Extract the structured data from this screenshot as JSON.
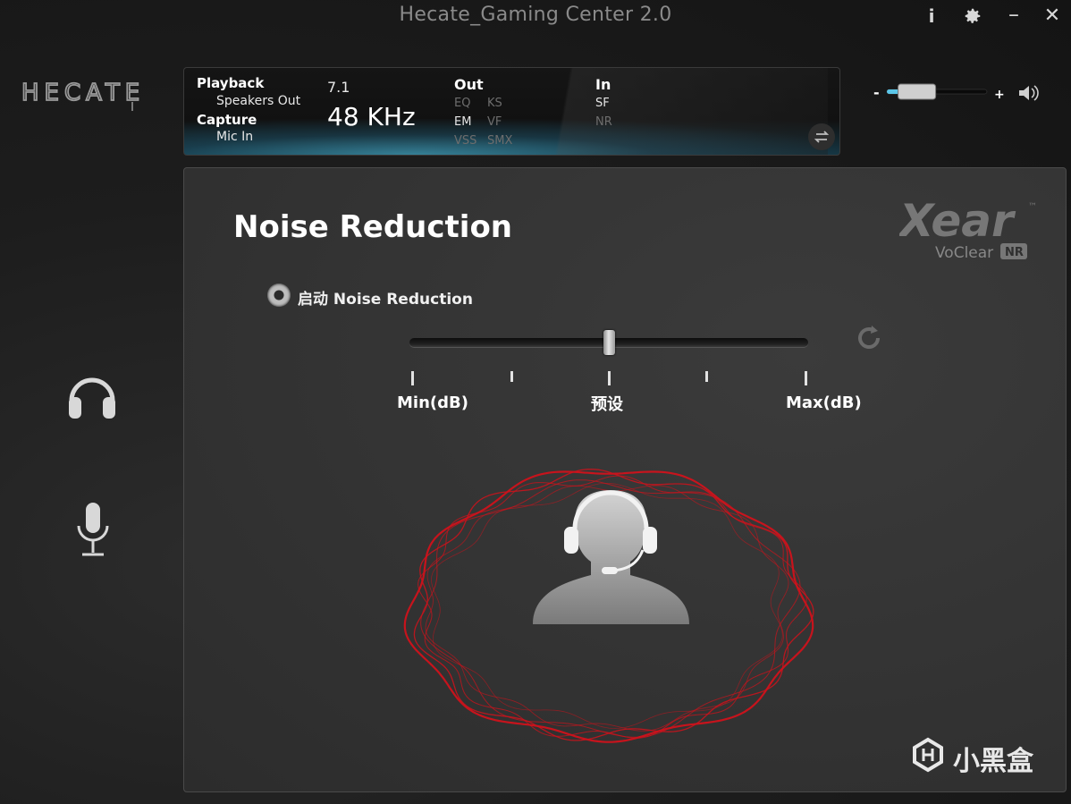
{
  "window": {
    "title": "Hecate_Gaming Center 2.0",
    "info_icon": "i",
    "settings_icon": "gear-icon",
    "minimize_label": "–",
    "close_label": "✕"
  },
  "brand": {
    "logo_text": "HECATE"
  },
  "status": {
    "playback_label": "Playback",
    "playback_device": "Speakers Out",
    "capture_label": "Capture",
    "capture_device": "Mic In",
    "channels": "7.1",
    "sample_rate": "48 KHz",
    "out_label": "Out",
    "out_items": [
      "EQ",
      "KS",
      "EM",
      "VF",
      "VSS",
      "SMX"
    ],
    "in_label": "In",
    "in_items": [
      "SF",
      "NR"
    ],
    "active_items": [
      "EM",
      "SF"
    ]
  },
  "volume": {
    "minus": "-",
    "plus": "+",
    "level": 0.3
  },
  "page": {
    "title": "Noise Reduction",
    "toggle_label": "启动 Noise Reduction",
    "slider": {
      "min_label": "Min(dB)",
      "mid_label": "预设",
      "max_label": "Max(dB)",
      "value": 0.5
    },
    "xear_brand": "Xear",
    "xear_sub": "VoClear",
    "xear_badge": "NR",
    "tm": "™"
  },
  "sidebar": {
    "items": [
      {
        "name": "headphone-icon"
      },
      {
        "name": "microphone-icon"
      }
    ]
  },
  "watermark": {
    "text": "小黑盒"
  },
  "colors": {
    "accent": "#5bc6e8",
    "wave": "#d0121b",
    "panel": "#333333"
  }
}
